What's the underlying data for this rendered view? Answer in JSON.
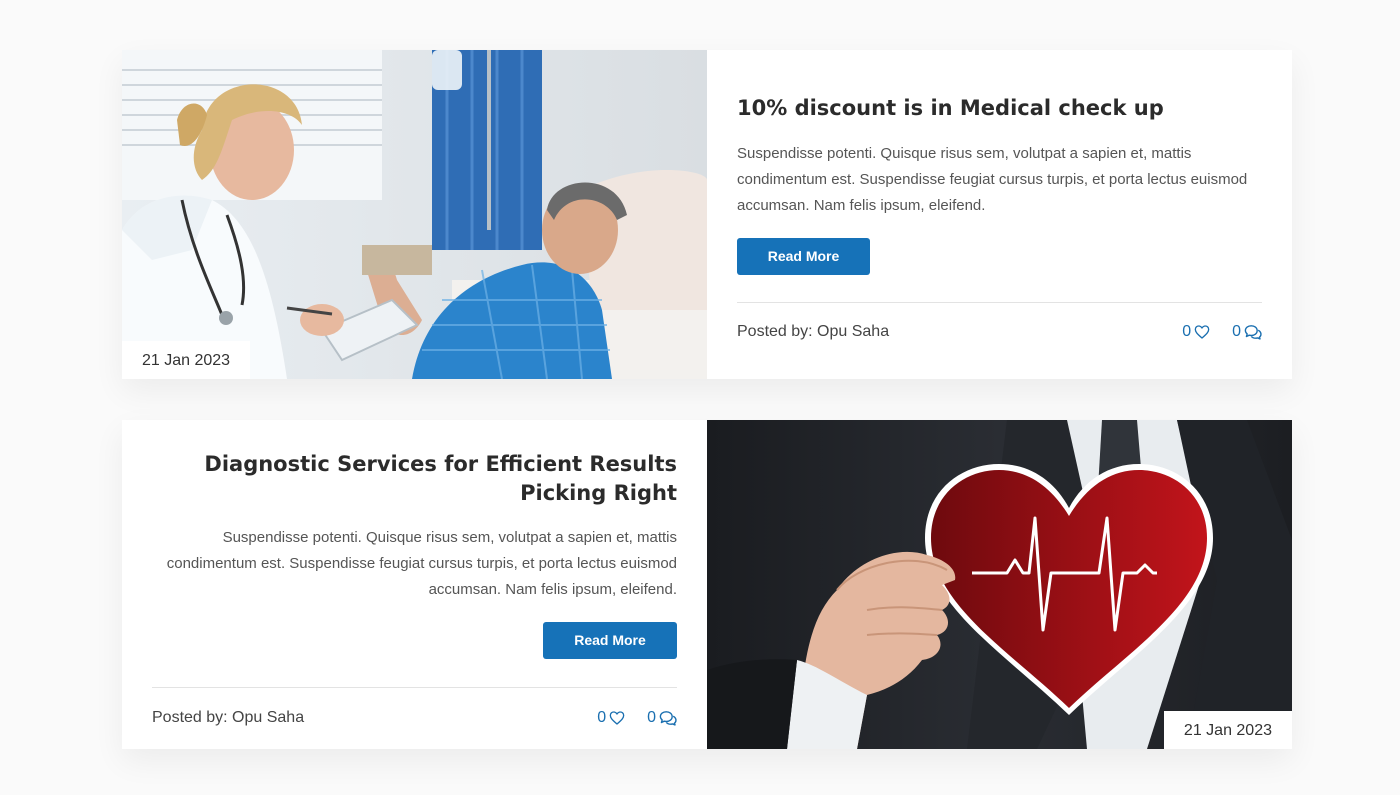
{
  "posts": [
    {
      "title": "10% discount is in Medical check up",
      "excerpt": "Suspendisse potenti. Quisque risus sem, volutpat a sapien et, mattis condimentum est. Suspendisse feugiat cursus turpis, et porta lectus euismod accumsan. Nam felis ipsum, eleifend.",
      "button_label": "Read More",
      "date": "21 Jan 2023",
      "posted_by": "Posted by: Opu Saha",
      "likes": "0",
      "comments": "0",
      "image": "doctor-with-patient-photo"
    },
    {
      "title": "Diagnostic Services for Efficient Results Picking Right",
      "excerpt": "Suspendisse potenti. Quisque risus sem, volutpat a sapien et, mattis condimentum est. Suspendisse feugiat cursus turpis, et porta lectus euismod accumsan. Nam felis ipsum, eleifend.",
      "button_label": "Read More",
      "date": "21 Jan 2023",
      "posted_by": "Posted by: Opu Saha",
      "likes": "0",
      "comments": "0",
      "image": "hand-holding-heart-photo"
    }
  ],
  "colors": {
    "accent": "#1672b8",
    "background": "#fafafa",
    "card": "#ffffff"
  },
  "icons": {
    "like": "heart-icon",
    "comment": "comments-icon"
  }
}
